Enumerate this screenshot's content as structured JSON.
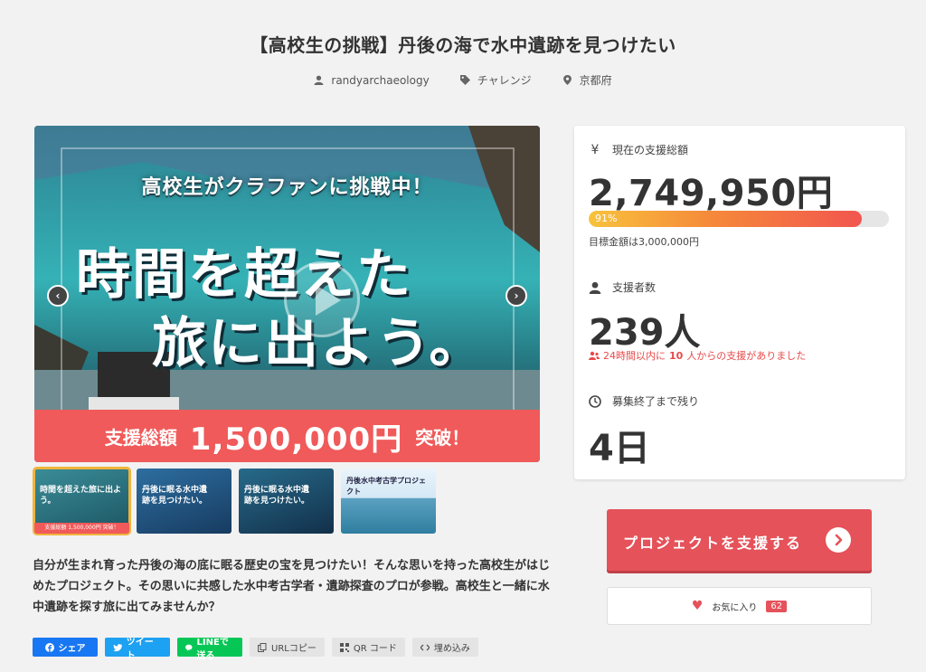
{
  "project": {
    "title": "【高校生の挑戦】丹後の海で水中遺跡を見つけたい",
    "author": "randyarchaeology",
    "category": "チャレンジ",
    "location": "京都府"
  },
  "hero": {
    "top_text": "高校生がクラファンに挑戦中！",
    "big_line1": "時間を超えた",
    "big_line2": "旅に出よう。",
    "banner_prefix": "支援総額",
    "banner_amount": "1,500,000円",
    "banner_suffix": "突破！",
    "prev_icon": "chevron-left-icon",
    "next_icon": "chevron-right-icon"
  },
  "thumbnails": [
    {
      "caption": "時間を超えた旅に出よう。",
      "sub": "支援総額 1,500,000円 突破！",
      "active": true
    },
    {
      "caption": "丹後に眠る水中遺跡を見つけたい。",
      "active": false
    },
    {
      "caption": "丹後に眠る水中遺跡を見つけたい。",
      "active": false
    },
    {
      "caption": "丹後水中考古学プロジェクト",
      "active": false
    }
  ],
  "description": "自分が生まれ育った丹後の海の底に眠る歴史の宝を見つけたい！そんな思いを持った高校生がはじめたプロジェクト。その思いに共感した水中考古学者・遺跡探査のプロが参戦。高校生と一緒に水中遺跡を探す旅に出てみませんか？",
  "share": {
    "facebook": "シェア",
    "twitter": "ツイート",
    "line": "LINEで送る",
    "copy_url": "URLコピー",
    "qr": "QR コード",
    "embed": "埋め込み"
  },
  "stats": {
    "amount_label": "現在の支援総額",
    "amount": "2,749,950円",
    "progress_percent": 91,
    "progress_text": "91%",
    "goal_text": "目標金額は3,000,000円",
    "supporters_label": "支援者数",
    "supporters": "239人",
    "recent_prefix": "24時間以内に",
    "recent_count": "10",
    "recent_suffix": "人からの支援がありました",
    "remaining_label": "募集終了まで残り",
    "remaining": "4日"
  },
  "actions": {
    "support_label": "プロジェクトを支援する",
    "favorite_label": "お気に入り",
    "favorite_count": "62"
  },
  "colors": {
    "accent": "#e5525a",
    "banner": "#f05a5a",
    "progress_start": "#f9c23c",
    "progress_end": "#f2554f"
  }
}
